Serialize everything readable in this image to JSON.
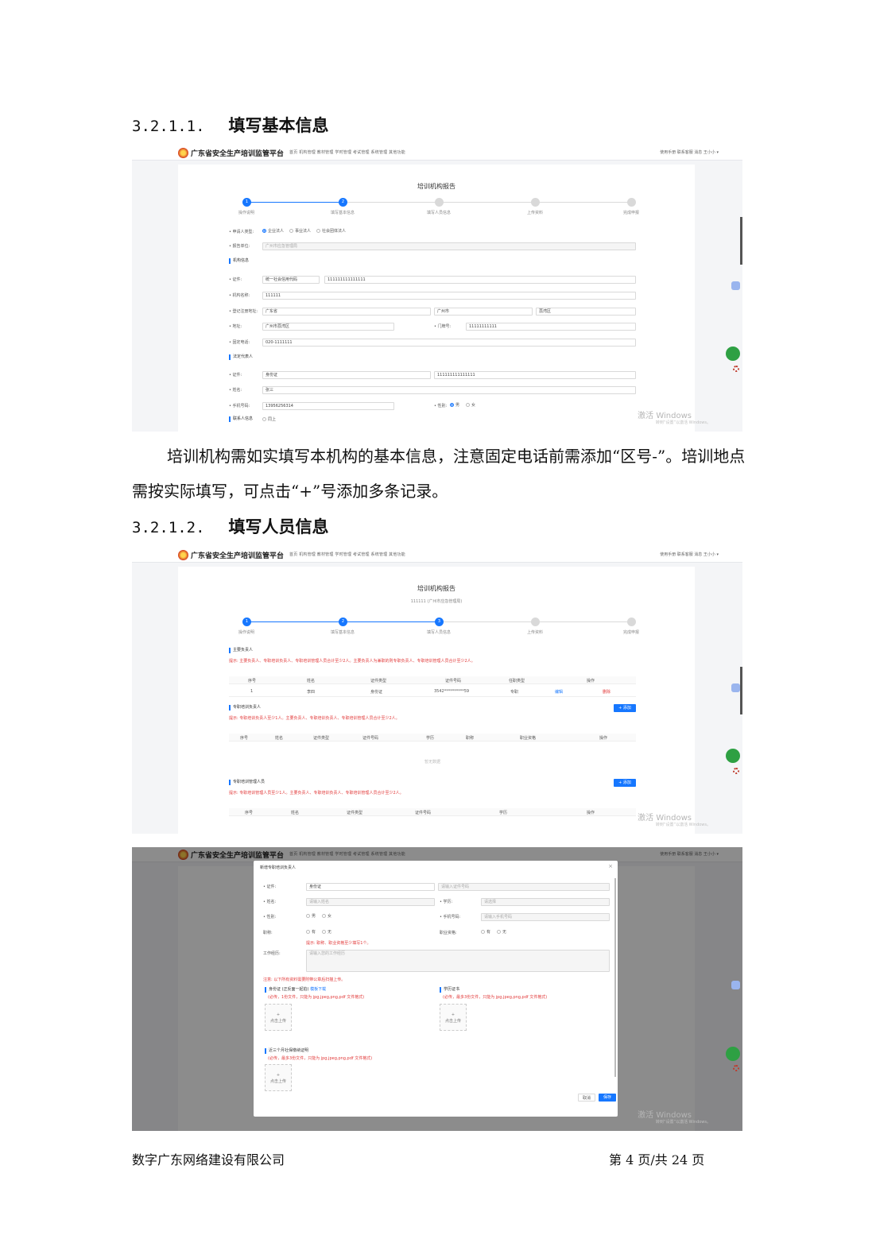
{
  "heading1": {
    "num": "3.2.1.1.",
    "title": "填写基本信息"
  },
  "heading2": {
    "num": "3.2.1.2.",
    "title": "填写人员信息"
  },
  "paragraph1": "培训机构需如实填写本机构的基本信息，注意固定电话前需添加“区号-”。培训地点需按实际填写，可点击“+”号添加多条记录。",
  "footer": {
    "company": "数字广东网络建设有限公司",
    "page": "第 4 页/共 24 页"
  },
  "app": {
    "brand": "广东省安全生产培训监管平台",
    "nav": "首页  机构管理  教材管理  学时管理  考试管理  系统管理  其他功能",
    "right": "使用手册  联系客服  消息  王小小 ▾",
    "watermark": "激活 Windows",
    "watermark_sub": "转到“设置”以激活 Windows。"
  },
  "form1": {
    "title": "培训机构报告",
    "steps": [
      "操作说明",
      "填写基本信息",
      "填写人员信息",
      "上传资料",
      "完成申报"
    ],
    "applicant_type_label": "• 申请人类型:",
    "applicant_types": [
      "企业法人",
      "事业法人",
      "社会团体法人"
    ],
    "unit_label": "• 报告单位:",
    "unit_value": "广州市应急管理局",
    "section_org": "机构信息",
    "cert_label": "• 证件:",
    "cert_type": "统一社会信用代码",
    "cert_no": "111111111111111",
    "org_name_label": "• 机构名称:",
    "org_name": "111111",
    "region_label": "• 登记注册地址:",
    "province": "广东省",
    "city": "广州市",
    "district": "荔湾区",
    "addr_label": "• 地址:",
    "addr": "广州市荔湾区",
    "house_label": "• 门牌号:",
    "house": "11111111111",
    "phone_label": "• 固定电话:",
    "phone": "020-1111111",
    "section_legal": "法定代表人",
    "legal_cert_label": "• 证件:",
    "legal_cert_type": "身份证",
    "legal_cert_no": "111111111111111",
    "legal_name_label": "• 姓名:",
    "legal_name": "张三",
    "mobile_label": "• 手机号码:",
    "mobile": "13956256314",
    "gender_label": "• 性别:",
    "gender_options": [
      "男",
      "女"
    ],
    "section_contact": "联系人信息",
    "contact_same": "同上"
  },
  "form2": {
    "title": "培训机构报告",
    "subtitle": "111111 (广州市应急管理局)",
    "steps": [
      "操作说明",
      "填写基本信息",
      "填写人员信息",
      "上传资料",
      "完成申报"
    ],
    "section_main": "主要负责人",
    "tip_main": "提示: 主要负责人、专职培训负责人、专职培训管理人员合计至少2人。主要负责人为兼职的则专职负责人、专职培训管理人员合计至少2人。",
    "main_headers": [
      "序号",
      "姓名",
      "证件类型",
      "证件号码",
      "任职类型",
      "操作"
    ],
    "main_row": [
      "1",
      "李四",
      "身份证",
      "3542**********59",
      "专职"
    ],
    "edit": "编辑",
    "delete": "删除",
    "section_head": "专职培训负责人",
    "tip_head": "提示: 专职培训负责人至少1人。主要负责人、专职培训负责人、专职培训管理人员合计至少2人。",
    "head_headers": [
      "序号",
      "姓名",
      "证件类型",
      "证件号码",
      "学历",
      "职称",
      "职业资格",
      "操作"
    ],
    "empty": "暂无数据",
    "add": "+ 添加",
    "section_staff": "专职培训管理人员",
    "tip_staff": "提示: 专职培训管理人员至少1人。主要负责人、专职培训负责人、专职培训管理人员合计至少2人。",
    "staff_headers": [
      "序号",
      "姓名",
      "证件类型",
      "证件号码",
      "学历",
      "操作"
    ]
  },
  "modal": {
    "title": "新增专职培训负责人",
    "cert_label": "• 证件:",
    "cert_type": "身份证",
    "cert_no_ph": "请输入证件号码",
    "name_label": "• 姓名:",
    "name_ph": "请输入姓名",
    "edu_label": "• 学历:",
    "edu_ph": "请选择",
    "gender_label": "• 性别:",
    "gender_options": [
      "男",
      "女"
    ],
    "mobile_label": "• 手机号码:",
    "mobile_ph": "请输入手机号码",
    "title_label": "职称:",
    "yes": "有",
    "no": "无",
    "qual_label": "职业资格:",
    "tip_title": "提示: 职称、职业资格至少填写1个。",
    "resume_label": "工作经历:",
    "resume_ph": "请输入您的工作经历",
    "upload_note": "注意: 以下所有资料需要附带公章后扫描上传。",
    "id_card_label": "身份证 (正反面一起拍)",
    "id_card_download": "模板下载",
    "id_card_hint": "(必传，1份文件，只能为 jpg,jpeg,png,pdf 文件格式)",
    "degree_label": "学历证书",
    "degree_hint": "(必传，最多3份文件，只能为 jpg,jpeg,png,pdf 文件格式)",
    "social_label": "近三个月社保缴纳证明",
    "social_hint": "(必传，最多3份文件，只能为 jpg,jpeg,png,pdf 文件格式)",
    "upload": "点击上传",
    "cancel": "取消",
    "save": "保存"
  }
}
